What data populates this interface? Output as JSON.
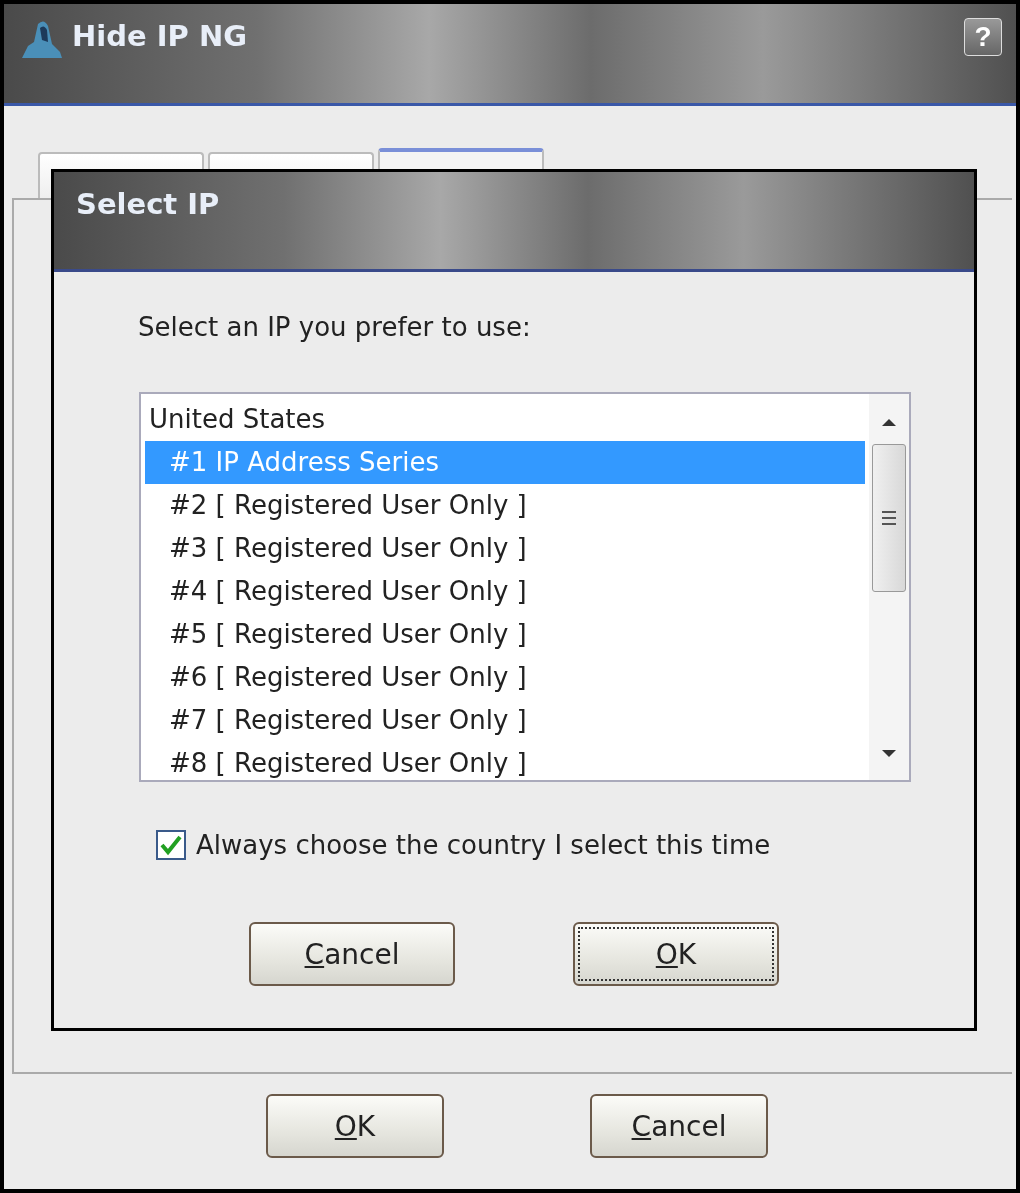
{
  "window": {
    "title": "Hide IP NG",
    "help_button": "?"
  },
  "tabs": [
    {
      "selected": false
    },
    {
      "selected": false
    },
    {
      "selected": true
    }
  ],
  "dialog": {
    "title": "Select IP",
    "prompt": "Select an IP you prefer to use:",
    "list": [
      {
        "kind": "header",
        "text": "United States",
        "selected": false
      },
      {
        "kind": "item",
        "text": "#1 IP Address Series",
        "selected": true
      },
      {
        "kind": "item",
        "text": "#2 [ Registered User Only ]",
        "selected": false
      },
      {
        "kind": "item",
        "text": "#3 [ Registered User Only ]",
        "selected": false
      },
      {
        "kind": "item",
        "text": "#4 [ Registered User Only ]",
        "selected": false
      },
      {
        "kind": "item",
        "text": "#5 [ Registered User Only ]",
        "selected": false
      },
      {
        "kind": "item",
        "text": "#6 [ Registered User Only ]",
        "selected": false
      },
      {
        "kind": "item",
        "text": "#7 [ Registered User Only ]",
        "selected": false
      },
      {
        "kind": "item",
        "text": "#8 [ Registered User Only ]",
        "selected": false
      }
    ],
    "checkbox": {
      "label": "Always choose the country I select this time",
      "checked": true
    },
    "buttons": [
      {
        "label": "Cancel",
        "focused": false,
        "access_key_underlined": true
      },
      {
        "label": "OK",
        "focused": true,
        "access_key_underlined": true
      }
    ]
  },
  "buttons": [
    {
      "label": "OK",
      "focused": false,
      "access_key_underlined": true
    },
    {
      "label": "Cancel",
      "focused": false,
      "access_key_underlined": true
    }
  ]
}
